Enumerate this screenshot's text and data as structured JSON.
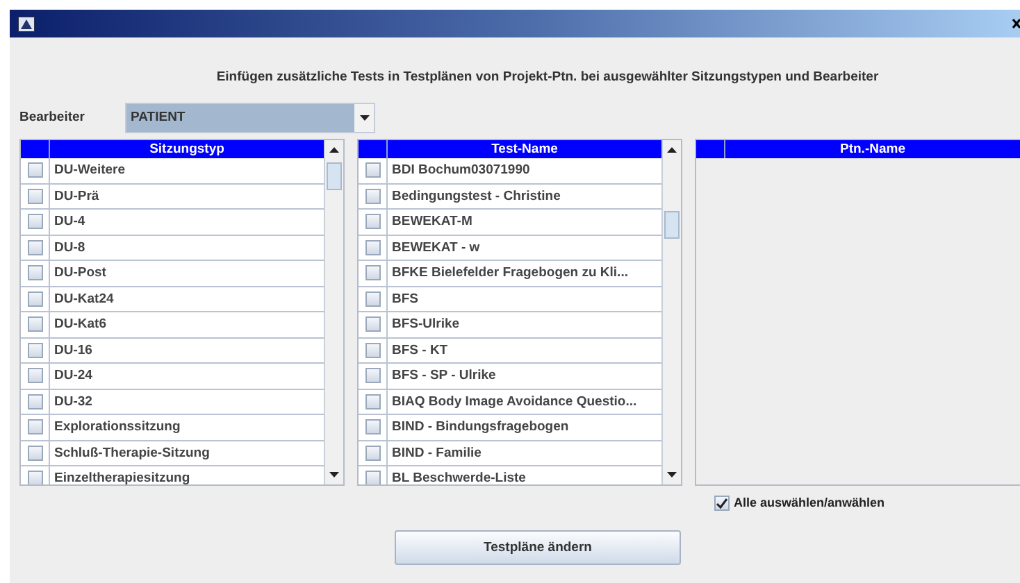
{
  "heading": "Einfügen zusätzliche Tests in Testplänen von Projekt-Ptn. bei ausgewählter Sitzungstypen und Bearbeiter",
  "editor": {
    "label": "Bearbeiter",
    "value": "PATIENT"
  },
  "tables": [
    {
      "column": "Sitzungstyp",
      "rows": [
        {
          "text": "DU-Weitere",
          "checked": false
        },
        {
          "text": "DU-Prä",
          "checked": false
        },
        {
          "text": "DU-4",
          "checked": false
        },
        {
          "text": "DU-8",
          "checked": false
        },
        {
          "text": "DU-Post",
          "checked": false
        },
        {
          "text": "DU-Kat24",
          "checked": false
        },
        {
          "text": "DU-Kat6",
          "checked": false
        },
        {
          "text": "DU-16",
          "checked": false
        },
        {
          "text": "DU-24",
          "checked": false
        },
        {
          "text": "DU-32",
          "checked": false
        },
        {
          "text": "Explorationssitzung",
          "checked": false
        },
        {
          "text": "Schluß-Therapie-Sitzung",
          "checked": false
        },
        {
          "text": "Einzeltherapiesitzung",
          "checked": false
        }
      ]
    },
    {
      "column": "Test-Name",
      "rows": [
        {
          "text": "BDI Bochum03071990",
          "checked": false
        },
        {
          "text": "Bedingungstest - Christine",
          "checked": false
        },
        {
          "text": "BEWEKAT-M",
          "checked": false
        },
        {
          "text": "BEWEKAT - w",
          "checked": false
        },
        {
          "text": "BFKE Bielefelder Fragebogen zu Kli...",
          "checked": false
        },
        {
          "text": "BFS",
          "checked": false
        },
        {
          "text": "BFS-Ulrike",
          "checked": false
        },
        {
          "text": "BFS - KT",
          "checked": false
        },
        {
          "text": "BFS - SP - Ulrike",
          "checked": false
        },
        {
          "text": "BIAQ Body Image Avoidance Questio...",
          "checked": false
        },
        {
          "text": "BIND - Bindungsfragebogen",
          "checked": false
        },
        {
          "text": "BIND - Familie",
          "checked": false
        },
        {
          "text": "BL Beschwerde-Liste",
          "checked": false
        }
      ]
    }
  ],
  "patients": {
    "column": "Ptn.-Name"
  },
  "select_all": {
    "label": "Alle auswählen/anwählen",
    "checked": true
  },
  "button": "Testpläne ändern"
}
